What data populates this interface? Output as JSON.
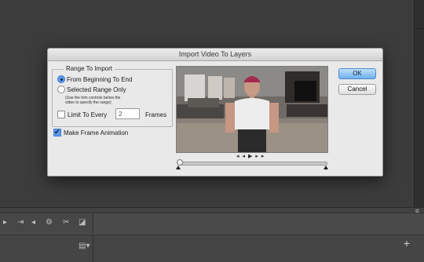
{
  "dialog": {
    "title": "Import Video To Layers",
    "range_group_title": "Range To Import",
    "option_from_beginning": "From Beginning To End",
    "option_selected_range": "Selected Range Only",
    "hint_line1": "(Use the trim controls below the",
    "hint_line2": "video to specify the range)",
    "limit_label": "Limit To Every",
    "limit_value": "2",
    "frames_label": "Frames",
    "make_frame_animation_label": "Make Frame Animation",
    "ok_label": "OK",
    "cancel_label": "Cancel",
    "selected_option": "From Beginning To End",
    "make_frame_animation_checked": true,
    "limit_checked": false
  },
  "playback": {
    "prev_icon": "step-back-icon",
    "play_icon": "play-icon",
    "next_icon": "step-forward-icon"
  },
  "colors": {
    "default_button": "#6fb0ee",
    "radio_selected": "#5c9ded",
    "app_background": "#3c3c3c"
  }
}
